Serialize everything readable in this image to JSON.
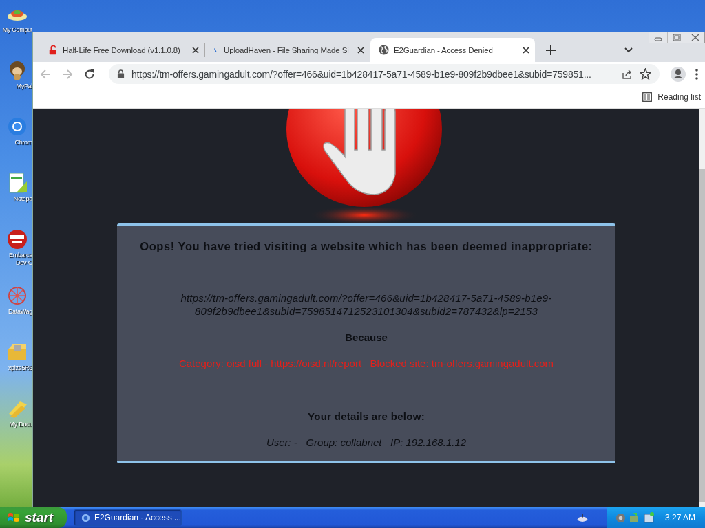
{
  "desktop": {
    "icons": [
      {
        "label": "My Comput",
        "kind": "plate"
      },
      {
        "label": "MyPal",
        "kind": "monkey"
      },
      {
        "label": "Chrom",
        "kind": "ring"
      },
      {
        "label": "Notepa",
        "kind": "notepad"
      },
      {
        "label": "Embarca Dev-C",
        "kind": "devcpp"
      },
      {
        "label": "DataWag",
        "kind": "web"
      },
      {
        "label": "xpize5R6",
        "kind": "box"
      },
      {
        "label": "My Docu",
        "kind": "docs"
      }
    ]
  },
  "browser": {
    "tabs": [
      {
        "title": "Half-Life Free Download (v1.1.0.8)",
        "kind": "lock",
        "selected": false
      },
      {
        "title": "UploadHaven - File Sharing Made Si",
        "kind": "spinner",
        "selected": false
      },
      {
        "title": "E2Guardian - Access Denied",
        "kind": "globe",
        "selected": true
      }
    ],
    "address": "https://tm-offers.gamingadult.com/?offer=466&uid=1b428417-5a71-4589-b1e9-809f2b9dbee1&subid=759851...",
    "reading_list": "Reading list",
    "page": {
      "heading": "Oops! You have tried visiting a website which has been deemed inappropriate:",
      "url_lines": [
        "https://tm-offers.gamingadult.com/?offer=466&uid=1b428417-5a71-4589-b1e9-",
        "809f2b9dbee1&subid=7598514712523101304&subid2=787432&lp=2153"
      ],
      "because": "Because",
      "reason": "Category: oisd full - https://oisd.nl/report   Blocked site: tm-offers.gamingadult.com",
      "details_heading": "Your details are below:",
      "details": "User: -   Group: collabnet   IP: 192.168.1.12"
    }
  },
  "taskbar": {
    "start": "start",
    "tasks": [
      {
        "label": "E2Guardian - Access ...",
        "selected": true
      }
    ],
    "clock": "3:27 AM"
  }
}
